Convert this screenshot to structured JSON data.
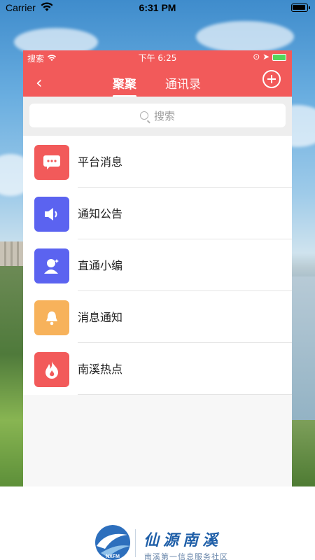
{
  "os_status": {
    "carrier": "Carrier",
    "time": "6:31 PM"
  },
  "app_status": {
    "carrier": "搜索",
    "time": "下午 6:25"
  },
  "nav": {
    "active_tab": "聚聚",
    "other_tab": "通讯录"
  },
  "search": {
    "placeholder": "搜索"
  },
  "items": [
    {
      "label": "平台消息",
      "icon": "message-icon",
      "color": "#f25a5a"
    },
    {
      "label": "通知公告",
      "icon": "speaker-icon",
      "color": "#5b63f0"
    },
    {
      "label": "直通小编",
      "icon": "editor-icon",
      "color": "#5b63f0"
    },
    {
      "label": "消息通知",
      "icon": "bell-icon",
      "color": "#f7b25b"
    },
    {
      "label": "南溪热点",
      "icon": "flame-icon",
      "color": "#f25a5a"
    }
  ],
  "brand": {
    "logo_text": "NXFM",
    "name": "仙源南溪",
    "subtitle": "南溪第一信息服务社区"
  },
  "colors": {
    "accent": "#f25a5a",
    "blue": "#5b63f0",
    "orange": "#f7b25b"
  }
}
